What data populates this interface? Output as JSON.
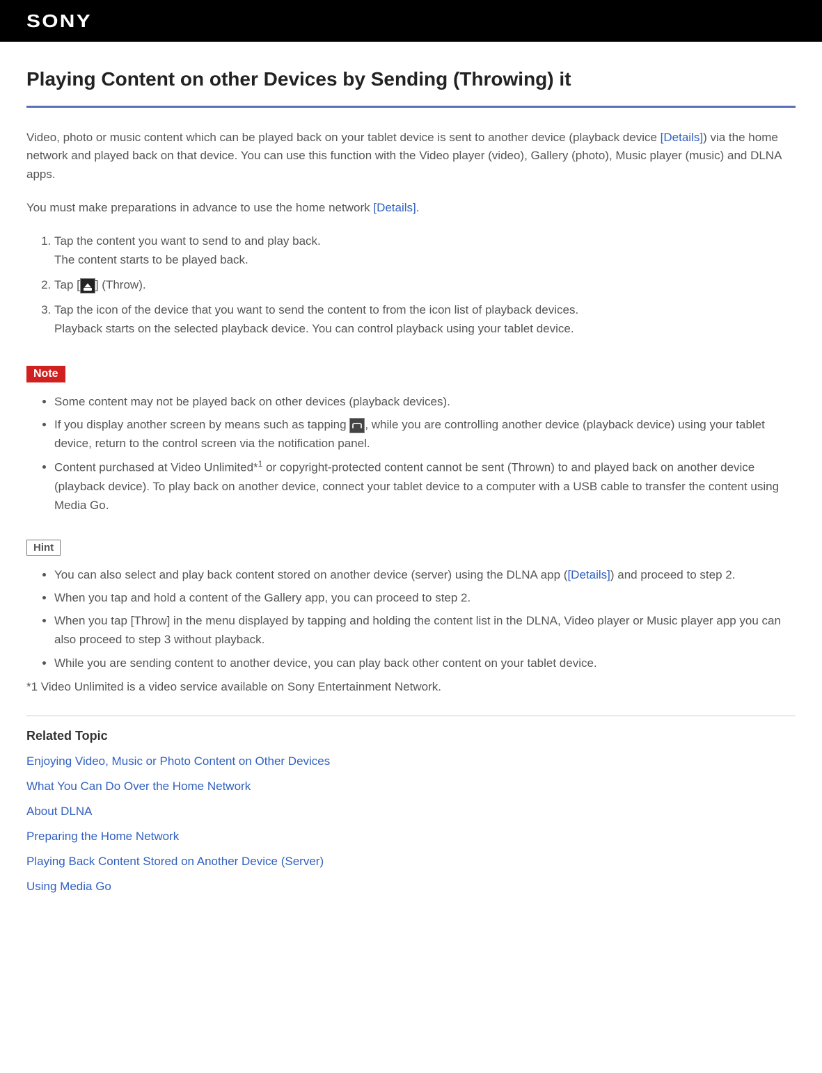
{
  "header": {
    "logo": "SONY"
  },
  "title": "Playing Content on other Devices by Sending (Throwing) it",
  "intro": {
    "part1": "Video, photo or music content which can be played back on your tablet device is sent to another device (playback device ",
    "link1": "[Details]",
    "part2": ") via the home network and played back on that device. You can use this function with the Video player (video), Gallery (photo), Music player (music) and DLNA apps."
  },
  "prep": {
    "part1": "You must make preparations in advance to use the home network ",
    "link": "[Details]",
    "part2": "."
  },
  "steps": [
    {
      "main": "Tap the content you want to send to and play back.",
      "sub": "The content starts to be played back."
    },
    {
      "pre": "Tap [",
      "post": "] (Throw).",
      "icon": "throw"
    },
    {
      "main": "Tap the icon of the device that you want to send the content to from the icon list of playback devices.",
      "sub": "Playback starts on the selected playback device. You can control playback using your tablet device."
    }
  ],
  "note_label": "Note",
  "notes": {
    "n1": "Some content may not be played back on other devices (playback devices).",
    "n2_pre": "If you display another screen by means such as tapping ",
    "n2_post": ", while you are controlling another device (playback device) using your tablet device, return to the control screen via the notification panel.",
    "n3_pre": "Content purchased at Video Unlimited*",
    "n3_sup": "1",
    "n3_post": " or copyright-protected content cannot be sent (Thrown) to and played back on another device (playback device). To play back on another device, connect your tablet device to a computer with a USB cable to transfer the content using Media Go."
  },
  "hint_label": "Hint",
  "hints": {
    "h1_pre": "You can also select and play back content stored on another device (server) using the DLNA app (",
    "h1_link": "[Details]",
    "h1_post": ") and proceed to step 2.",
    "h2": "When you tap and hold a content of the Gallery app, you can proceed to step 2.",
    "h3": "When you tap [Throw] in the menu displayed by tapping and holding the content list in the DLNA, Video player or Music player app you can also proceed to step 3 without playback.",
    "h4": "While you are sending content to another device, you can play back other content on your tablet device."
  },
  "footnote": "*1 Video Unlimited is a video service available on Sony Entertainment Network.",
  "related_heading": "Related Topic",
  "related": [
    "Enjoying Video, Music or Photo Content on Other Devices",
    "What You Can Do Over the Home Network",
    "About DLNA",
    "Preparing the Home Network",
    "Playing Back Content Stored on Another Device (Server)",
    "Using Media Go"
  ]
}
